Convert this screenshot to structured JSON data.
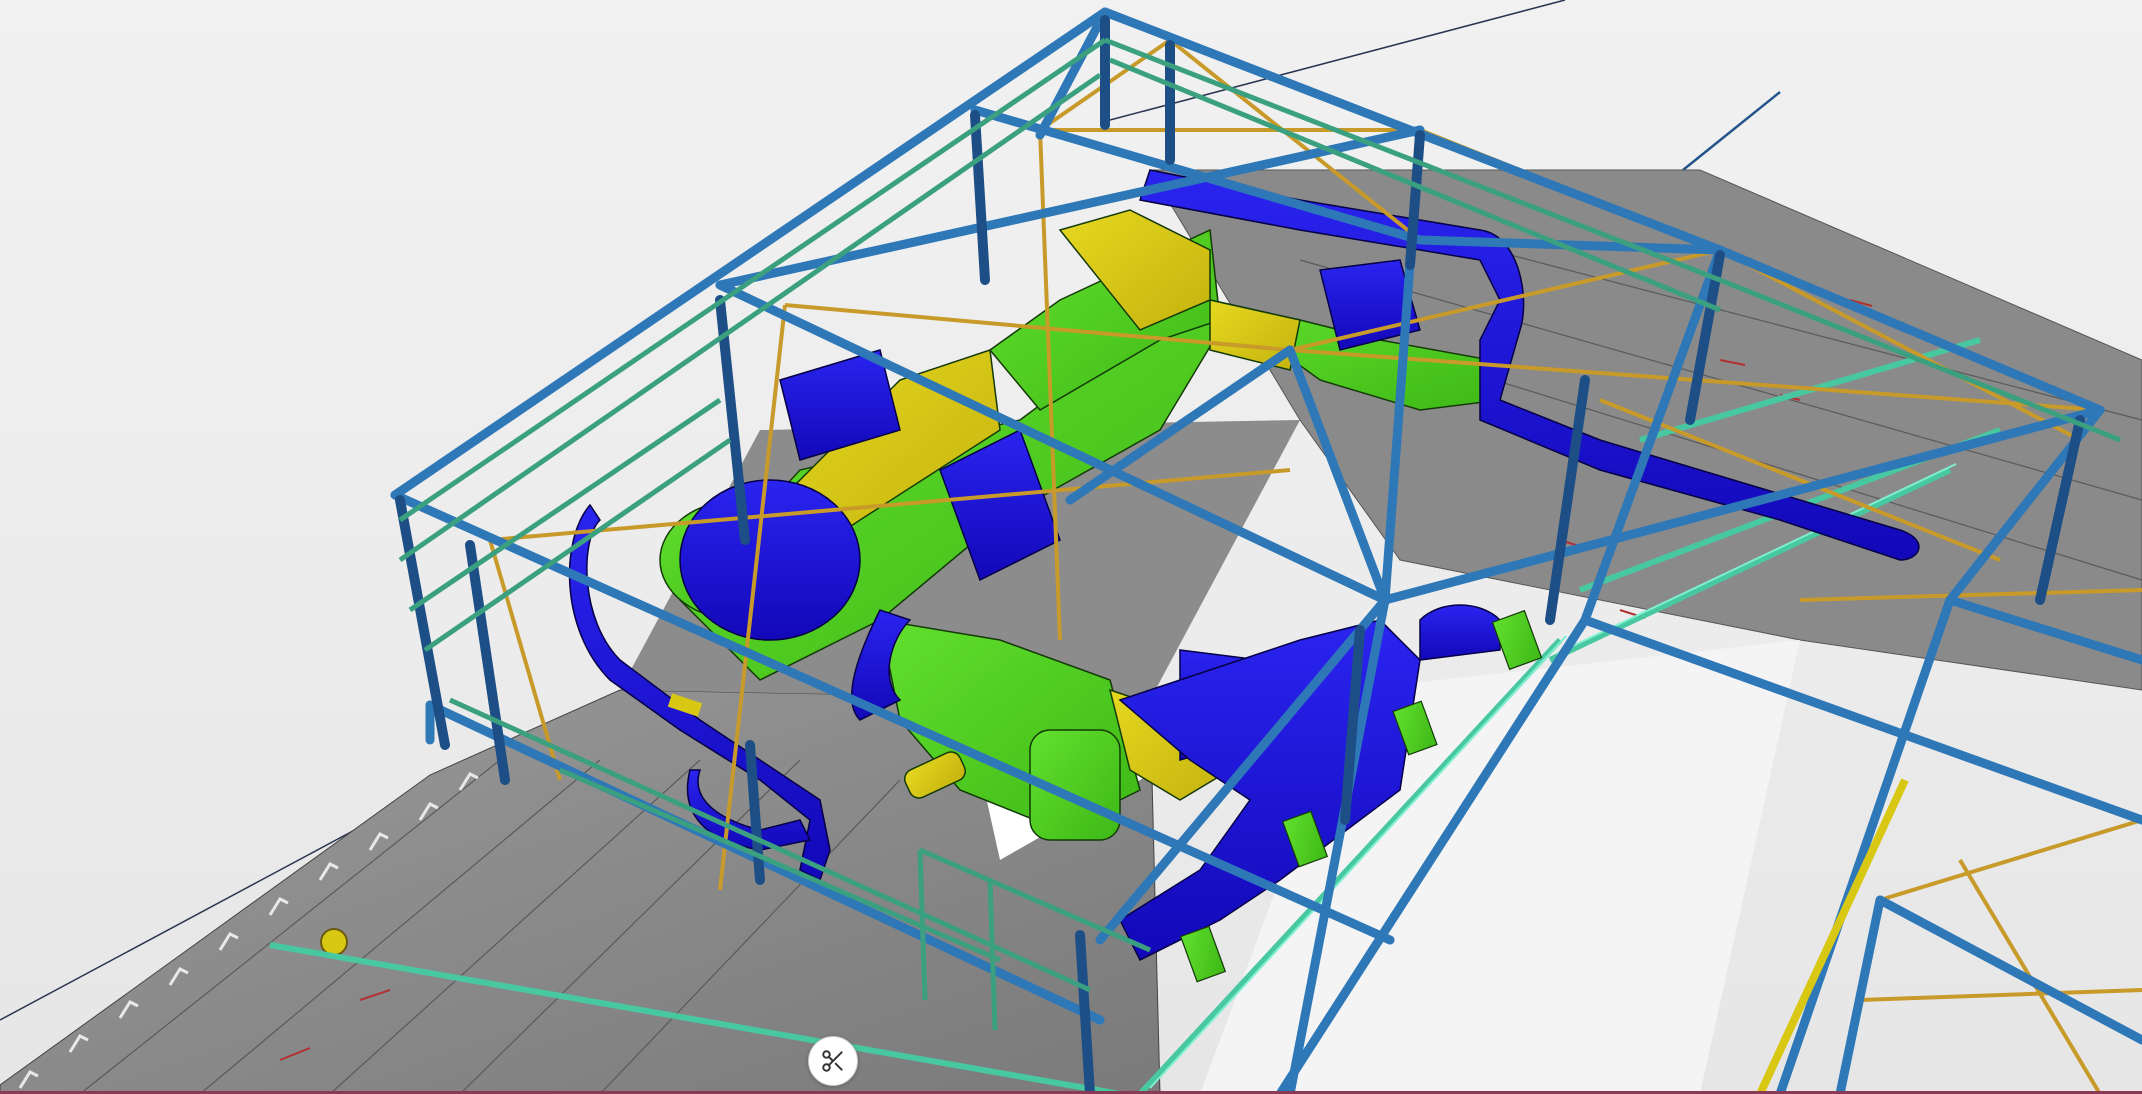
{
  "viewer": {
    "section_tool": {
      "icon": "scissors-icon",
      "label": ""
    }
  },
  "colors": {
    "background": "#ededed",
    "structural_steel": "#2e78b8",
    "structural_steel_dark": "#1d4f86",
    "bracing": "#c89a2a",
    "duct_blue": "#1a14d8",
    "equipment_green": "#4fd21e",
    "equipment_yellow": "#d8c814",
    "floor_grey": "#8e8e8e",
    "rail_teal": "#48c8a0",
    "accent_bottom": "#8a3a55"
  }
}
